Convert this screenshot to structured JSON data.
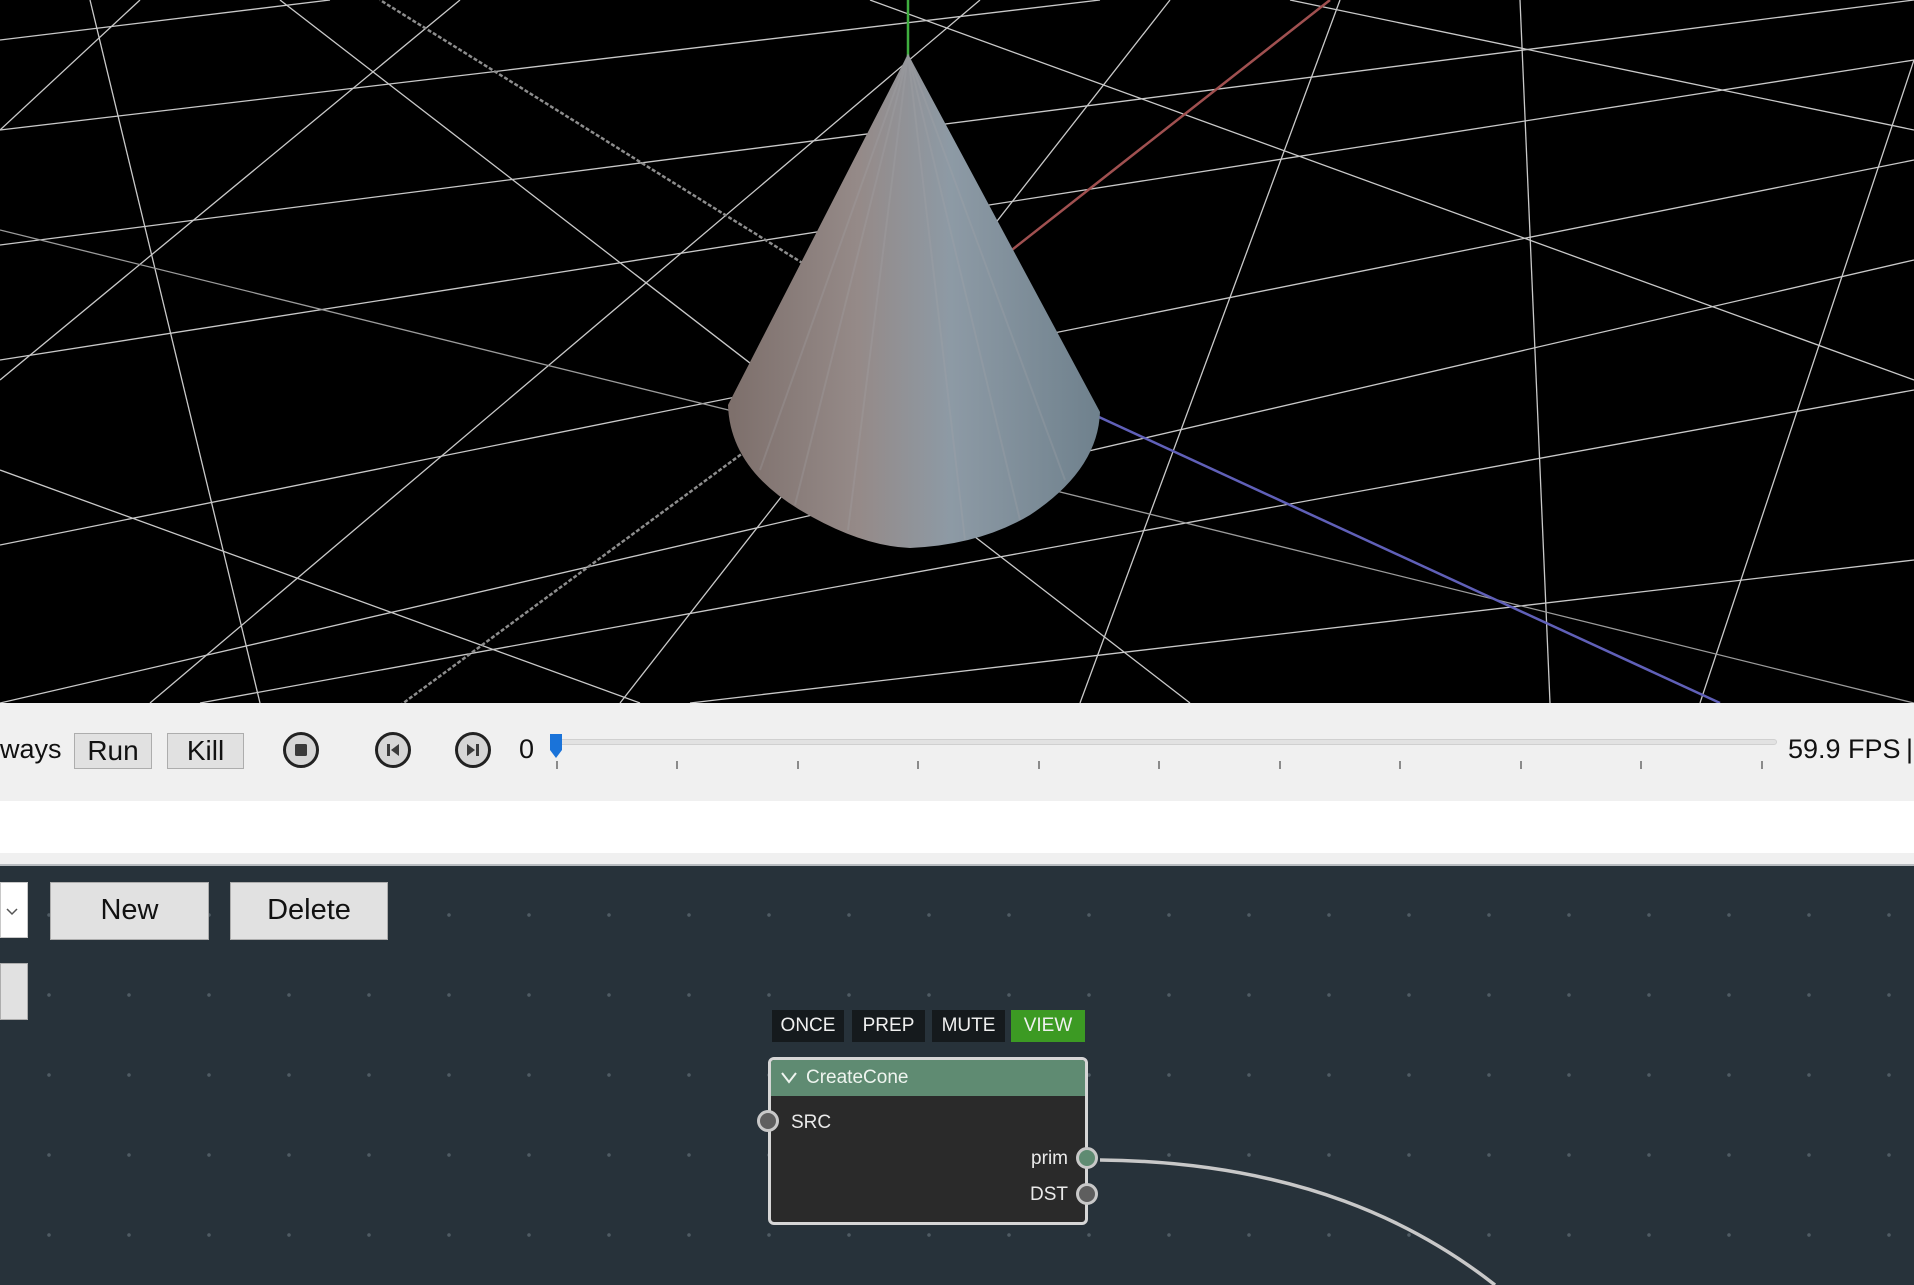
{
  "toolbar": {
    "mode_partial": "ways",
    "run_label": "Run",
    "kill_label": "Kill",
    "frame": "0",
    "fps": "59.9 FPS",
    "fps_separator": "|"
  },
  "graph": {
    "new_label": "New",
    "delete_label": "Delete",
    "flags": [
      "ONCE",
      "PREP",
      "MUTE",
      "VIEW"
    ],
    "node": {
      "title": "CreateCone",
      "inputs": [
        "SRC"
      ],
      "outputs": [
        "prim",
        "DST"
      ]
    }
  },
  "colors": {
    "view_flag_active": "#3c9a23",
    "node_header": "#5f8b72",
    "graph_background": "#27323a",
    "axis_x": "#a05050",
    "axis_y": "#3fae3f",
    "axis_z": "#6060b8",
    "slider_handle": "#1a73d9"
  },
  "icons": {
    "collapse": "chevron-down-icon",
    "stop": "stop-icon",
    "step_back": "step-back-icon",
    "step_forward": "step-forward-icon"
  }
}
